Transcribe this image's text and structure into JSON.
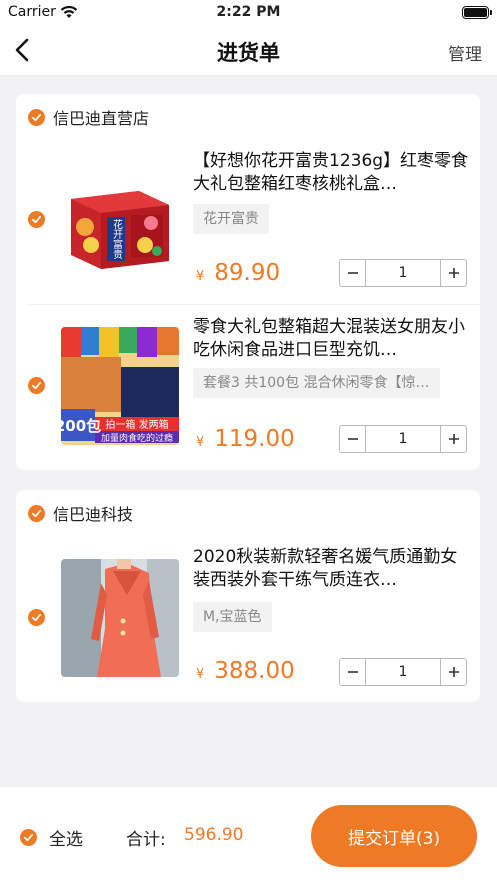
{
  "status_bar": {
    "carrier": "Carrier",
    "time": "2:22 PM"
  },
  "nav": {
    "title": "进货单",
    "manage": "管理"
  },
  "shops": [
    {
      "name": "信巴迪直营店",
      "items": [
        {
          "name": "【好想你花开富贵1236g】红枣零食大礼包整箱红枣核桃礼盒…",
          "spec": "花开富贵",
          "currency": "¥",
          "price": "89.90",
          "qty": "1",
          "thumb_icon": "gift-box-image",
          "thumb_text": "花开富贵"
        },
        {
          "name": "零食大礼包整箱超大混装送女朋友小吃休闲食品进口巨型充饥…",
          "spec": "套餐3 共100包 混合休闲零食【惊…",
          "currency": "¥",
          "price": "119.00",
          "qty": "1",
          "thumb_icon": "snack-pack-image",
          "thumb_badge": "200包",
          "thumb_banner1": "拍一箱 发两箱",
          "thumb_banner2": "加量肉食吃的过瘾"
        }
      ]
    },
    {
      "name": "信巴迪科技",
      "items": [
        {
          "name": "2020秋装新款轻奢名媛气质通勤女装西装外套干练气质连衣…",
          "spec": "M,宝蓝色",
          "currency": "¥",
          "price": "388.00",
          "qty": "1",
          "thumb_icon": "dress-image"
        }
      ]
    }
  ],
  "bottom": {
    "select_all": "全选",
    "total_label": "合计:",
    "total_value": "596.90",
    "submit": "提交订单(3)"
  },
  "colors": {
    "accent": "#ef7a26",
    "background": "#f2f2f4"
  }
}
